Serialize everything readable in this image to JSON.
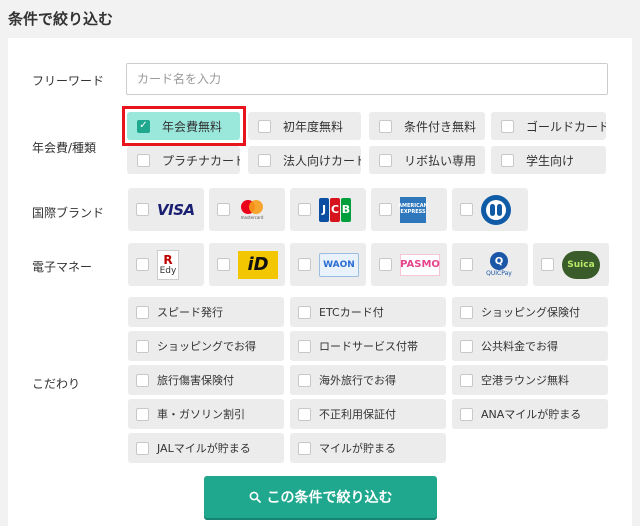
{
  "heading": "条件で絞り込む",
  "freeword": {
    "label": "フリーワード",
    "placeholder": "カード名を入力"
  },
  "annual_fee": {
    "label": "年会費/種類",
    "options": [
      {
        "label": "年会費無料",
        "checked": true
      },
      {
        "label": "初年度無料",
        "checked": false
      },
      {
        "label": "条件付き無料",
        "checked": false
      },
      {
        "label": "ゴールドカード",
        "checked": false
      },
      {
        "label": "プラチナカード",
        "checked": false
      },
      {
        "label": "法人向けカード",
        "checked": false
      },
      {
        "label": "リボ払い専用",
        "checked": false
      },
      {
        "label": "学生向け",
        "checked": false
      }
    ]
  },
  "brands": {
    "label": "国際ブランド",
    "options": [
      {
        "icon": "visa-logo",
        "text": "VISA"
      },
      {
        "icon": "mastercard-logo",
        "text": "mastercard"
      },
      {
        "icon": "jcb-logo",
        "text": "JCB"
      },
      {
        "icon": "amex-logo",
        "text": "AMERICAN EXPRESS"
      },
      {
        "icon": "diners-logo",
        "text": ""
      }
    ]
  },
  "emoney": {
    "label": "電子マネー",
    "options": [
      {
        "icon": "rakuten-edy-logo",
        "text": "Edy",
        "mark": "R"
      },
      {
        "icon": "id-logo",
        "text": "iD"
      },
      {
        "icon": "waon-logo",
        "text": "WAON"
      },
      {
        "icon": "pasmo-logo",
        "text": "PASMO"
      },
      {
        "icon": "quicpay-logo",
        "text": "QUICPay",
        "mark": "Q"
      },
      {
        "icon": "suica-logo",
        "text": "Suica"
      }
    ]
  },
  "features": {
    "label": "こだわり",
    "options": [
      "スピード発行",
      "ETCカード付",
      "ショッピング保険付",
      "ショッピングでお得",
      "ロードサービス付帯",
      "公共料金でお得",
      "旅行傷害保険付",
      "海外旅行でお得",
      "空港ラウンジ無料",
      "車・ガソリン割引",
      "不正利用保証付",
      "ANAマイルが貯まる",
      "JALマイルが貯まる",
      "マイルが貯まる"
    ]
  },
  "submit": {
    "label": "この条件で絞り込む",
    "icon": "search-icon"
  },
  "colors": {
    "accent": "#1fa88e",
    "checked_bg": "#9ae8dc",
    "highlight": "#e8141c"
  }
}
